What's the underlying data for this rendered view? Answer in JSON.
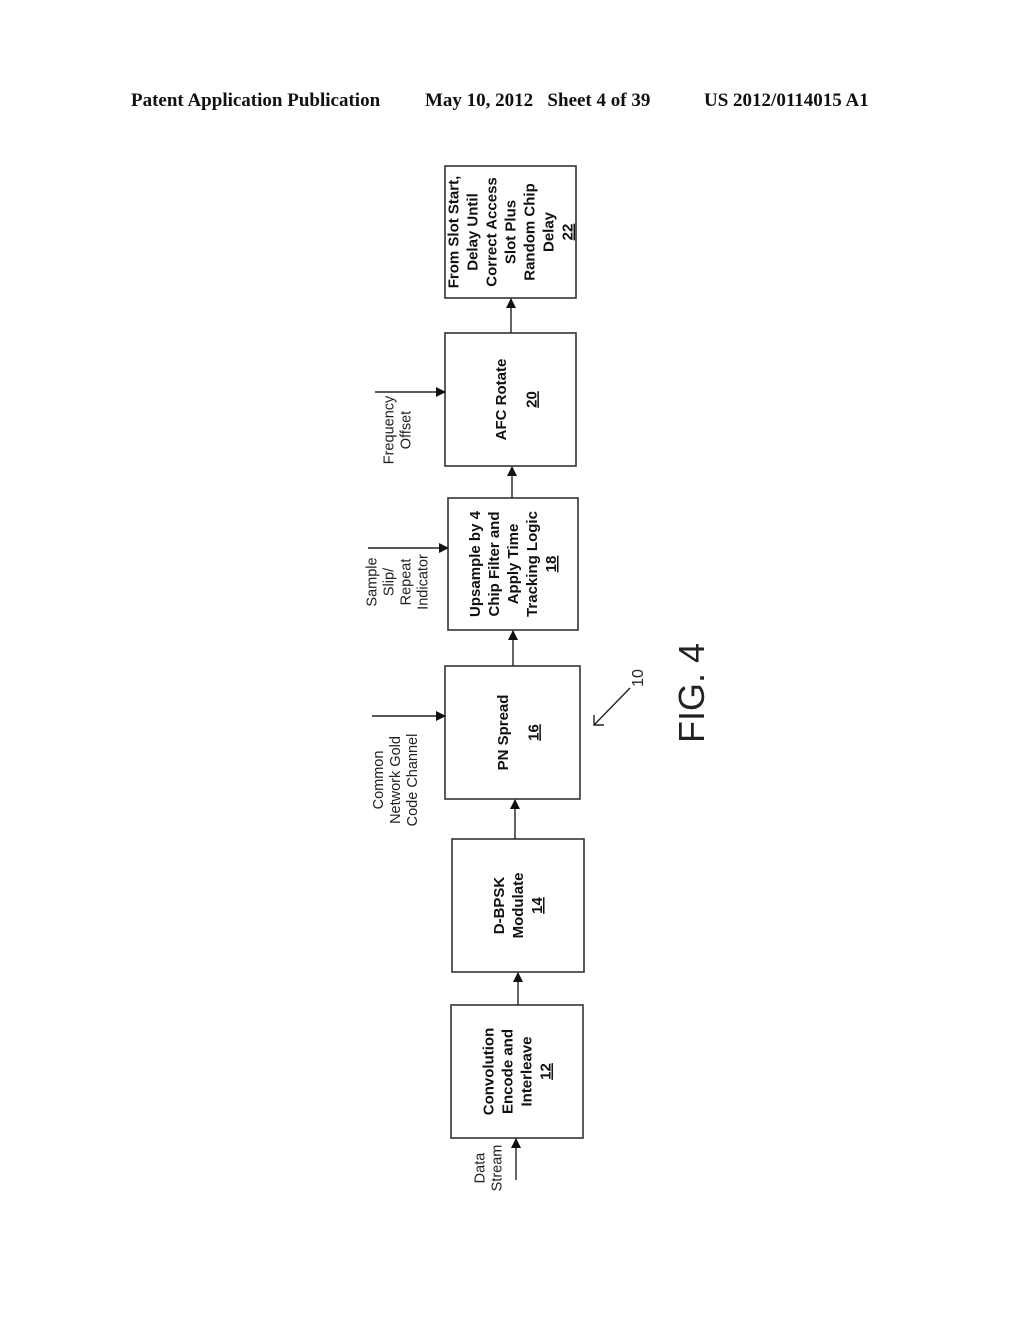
{
  "header": {
    "publication": "Patent Application Publication",
    "date_sheet": "May 10, 2012   Sheet 4 of 39",
    "patent_number": "US 2012/0114015 A1"
  },
  "figure": {
    "label": "FIG. 4",
    "reference": "10"
  },
  "blocks": [
    {
      "id": "12",
      "lines": [
        "Convolution",
        "Encode and",
        "Interleave"
      ],
      "ref": "12"
    },
    {
      "id": "14",
      "lines": [
        "D-BPSK",
        "Modulate"
      ],
      "ref": "14"
    },
    {
      "id": "16",
      "lines": [
        "PN Spread"
      ],
      "ref": "16"
    },
    {
      "id": "18",
      "lines": [
        "Upsample by 4",
        "Chip Filter and",
        "Apply Time",
        "Tracking Logic"
      ],
      "ref": "18"
    },
    {
      "id": "20",
      "lines": [
        "AFC Rotate"
      ],
      "ref": "20"
    },
    {
      "id": "22",
      "lines": [
        "From Slot Start,",
        "Delay Until",
        "Correct Access",
        "Slot Plus",
        "Random Chip",
        "Delay"
      ],
      "ref": "22"
    }
  ],
  "inputs": [
    {
      "target": "12",
      "lines": [
        "Data",
        "Stream"
      ]
    },
    {
      "target": "16",
      "lines": [
        "Common",
        "Network Gold",
        "Code Channel"
      ]
    },
    {
      "target": "18",
      "lines": [
        "Sample",
        "Slip/",
        "Repeat",
        "Indicator"
      ]
    },
    {
      "target": "20",
      "lines": [
        "Frequency",
        "Offset"
      ]
    }
  ]
}
